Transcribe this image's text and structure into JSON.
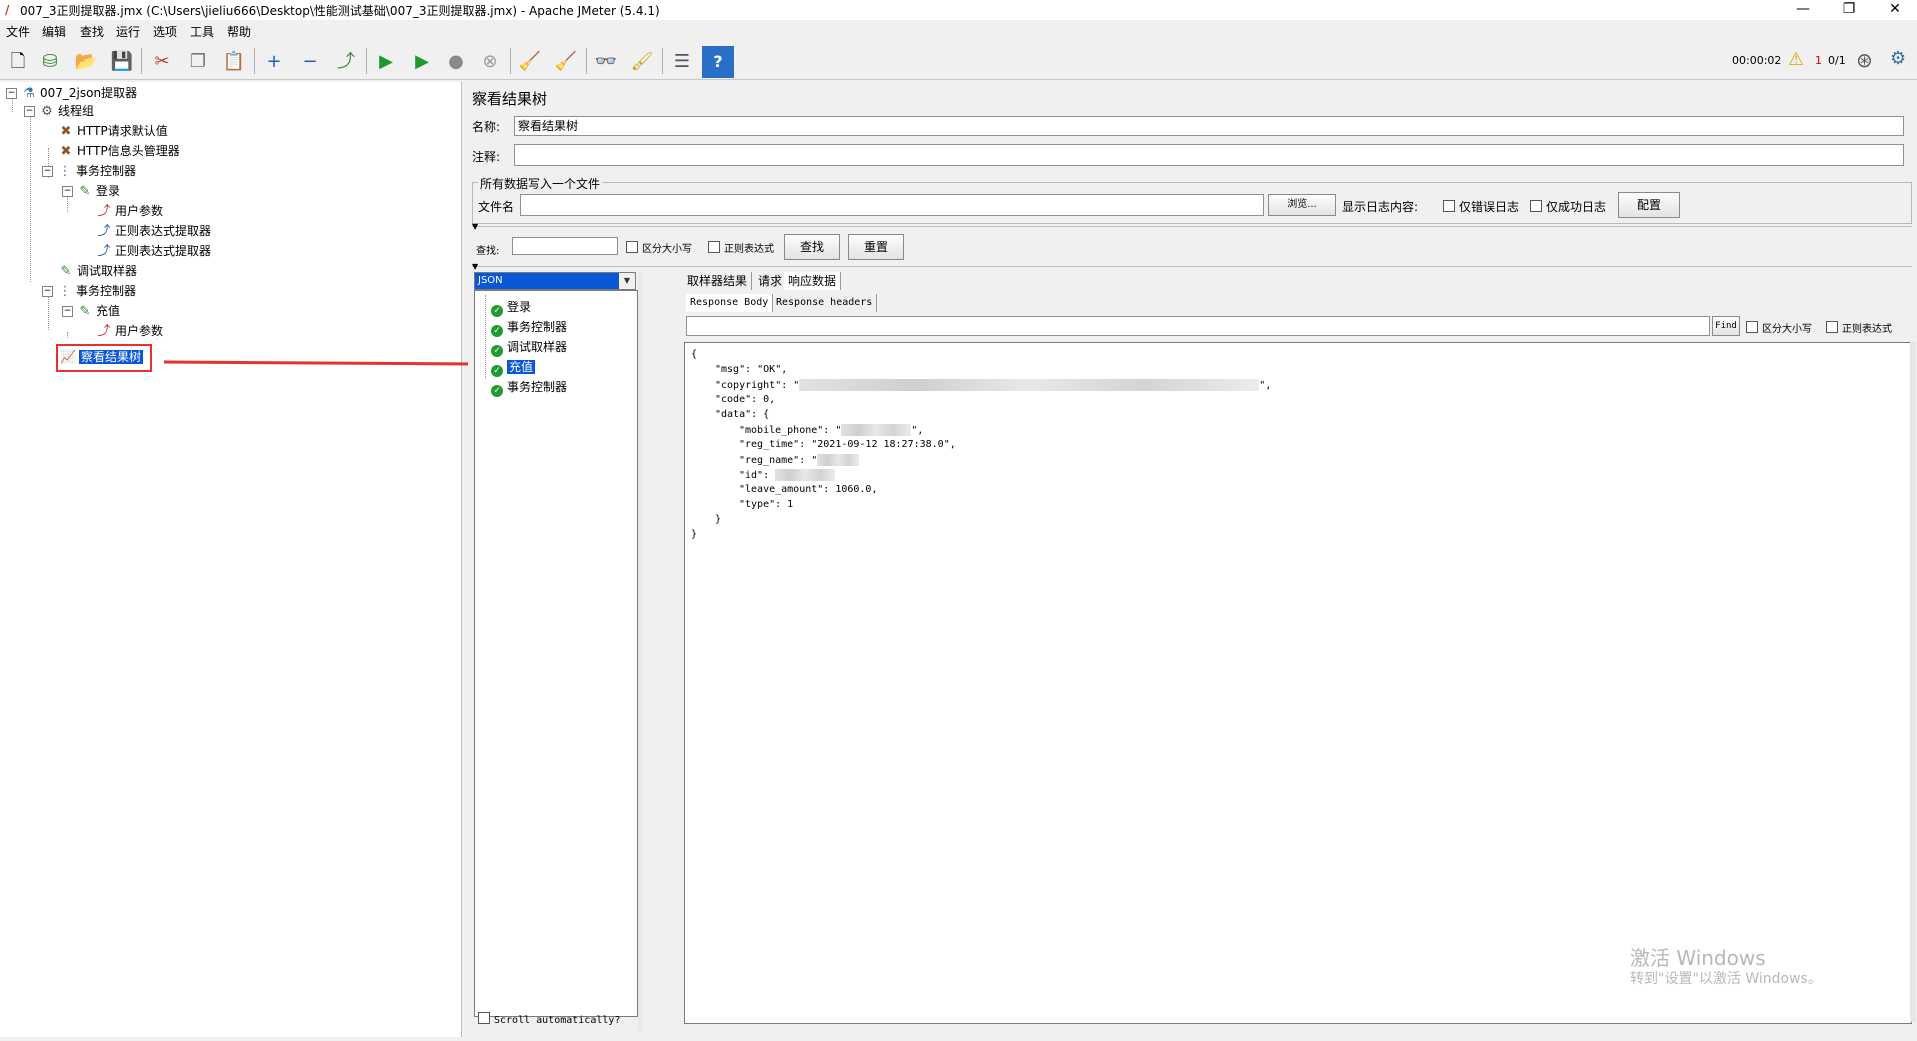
{
  "window": {
    "title": "007_3正则提取器.jmx (C:\\Users\\jieliu666\\Desktop\\性能测试基础\\007_3正则提取器.jmx) - Apache JMeter (5.4.1)",
    "min": "—",
    "max": "❐",
    "close": "✕"
  },
  "menu": [
    "文件",
    "编辑",
    "查找",
    "运行",
    "选项",
    "工具",
    "帮助"
  ],
  "toolbar": {
    "timer": "00:00:02",
    "warn_count": "1",
    "threads": "0/1"
  },
  "tree": {
    "root": "007_2json提取器",
    "thread_group": "线程组",
    "http_defaults": "HTTP请求默认值",
    "http_headers": "HTTP信息头管理器",
    "tx1": "事务控制器",
    "login": "登录",
    "user_params1": "用户参数",
    "regex1": "正则表达式提取器",
    "regex2": "正则表达式提取器",
    "debug": "调试取样器",
    "tx2": "事务控制器",
    "recharge": "充值",
    "user_params2": "用户参数",
    "result_tree": "察看结果树"
  },
  "panel": {
    "title": "察看结果树",
    "name_label": "名称:",
    "name_value": "察看结果树",
    "comment_label": "注释:",
    "file_group": "所有数据写入一个文件",
    "file_label": "文件名",
    "browse": "浏览...",
    "log_label": "显示日志内容:",
    "errors_only": "仅错误日志",
    "success_only": "仅成功日志",
    "config": "配置",
    "search_label": "查找:",
    "case_sensitive": "区分大小写",
    "regex": "正则表达式",
    "find_btn": "查找",
    "reset_btn": "重置",
    "renderer": "JSON",
    "scroll_auto": "Scroll automatically?"
  },
  "results": [
    "登录",
    "事务控制器",
    "调试取样器",
    "充值",
    "事务控制器"
  ],
  "tabs": [
    "取样器结果",
    "请求",
    "响应数据"
  ],
  "subtabs": [
    "Response Body",
    "Response headers"
  ],
  "find": {
    "button": "Find",
    "case": "区分大小写",
    "regex": "正则表达式"
  },
  "response": {
    "open": "{",
    "msg": "\"msg\": \"OK\",",
    "copyright_key": "\"copyright\": \"",
    "copyright_end": "\",",
    "code": "\"code\": 0,",
    "data_open": "\"data\": {",
    "mobile_key": "\"mobile_phone\": \"",
    "mobile_end": "\",",
    "reg_time": "\"reg_time\": \"2021-09-12 18:27:38.0\",",
    "reg_name_key": "\"reg_name\": \"",
    "id_key": "\"id\": ",
    "leave_amount": "\"leave_amount\": 1060.0,",
    "type": "\"type\": 1",
    "data_close": "}",
    "close": "}"
  },
  "watermark": {
    "line1": "激活 Windows",
    "line2": "转到\"设置\"以激活 Windows。"
  },
  "colors": {
    "selection": "#0a57d6",
    "annotation": "#e8312f",
    "ok_green": "#1e9a2f"
  },
  "icons": [
    "new-icon",
    "templates-icon",
    "open-icon",
    "save-icon",
    "cut-icon",
    "copy-icon",
    "paste-icon",
    "expand-icon",
    "collapse-icon",
    "toggle-icon",
    "start-icon",
    "start-no-pause-icon",
    "stop-icon",
    "shutdown-icon",
    "clear-icon",
    "clear-all-icon",
    "search-icon",
    "reset-search-icon",
    "function-helper-icon",
    "help-icon"
  ]
}
